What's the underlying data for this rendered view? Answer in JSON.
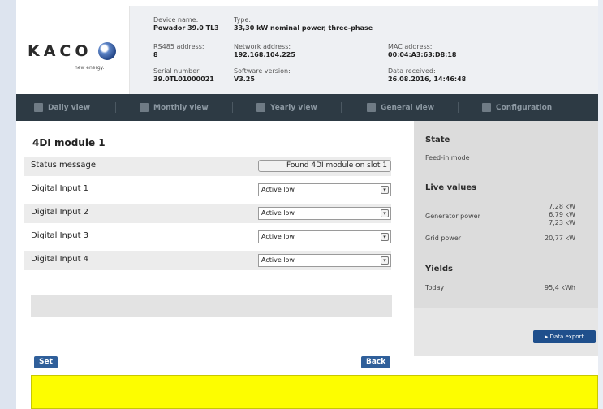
{
  "brand": {
    "logo": "KACO",
    "tagline": "new energy."
  },
  "device": {
    "device_name_label": "Device name:",
    "device_name": "Powador 39.0 TL3",
    "type_label": "Type:",
    "type": "33,30 kW nominal power, three-phase",
    "rs485_label": "RS485 address:",
    "rs485": "8",
    "network_label": "Network address:",
    "network": "192.168.104.225",
    "mac_label": "MAC address:",
    "mac": "00:04:A3:63:D8:18",
    "serial_label": "Serial number:",
    "serial": "39.0TL01000021",
    "software_label": "Software version:",
    "software": "V3.25",
    "received_label": "Data received:",
    "received": "26.08.2016, 14:46:48"
  },
  "nav": {
    "daily": "Daily view",
    "monthly": "Monthly view",
    "yearly": "Yearly view",
    "general": "General view",
    "config": "Configuration"
  },
  "module": {
    "title": "4DI module 1",
    "status_label": "Status message",
    "status_value": "Found 4DI module on slot 1",
    "inputs": [
      {
        "label": "Digital Input 1",
        "value": "Active low"
      },
      {
        "label": "Digital Input 2",
        "value": "Active low"
      },
      {
        "label": "Digital Input 3",
        "value": "Active low"
      },
      {
        "label": "Digital Input 4",
        "value": "Active low"
      }
    ],
    "set_button": "Set",
    "back_button": "Back"
  },
  "side": {
    "state_title": "State",
    "state_value": "Feed-in mode",
    "live_title": "Live values",
    "generator_label": "Generator power",
    "generator_values": [
      "7,28 kW",
      "6,79 kW",
      "7,23 kW"
    ],
    "grid_label": "Grid power",
    "grid_value": "20,77 kW",
    "yields_title": "Yields",
    "today_label": "Today",
    "today_value": "95,4 kWh",
    "export_button": "▸ Data export"
  }
}
